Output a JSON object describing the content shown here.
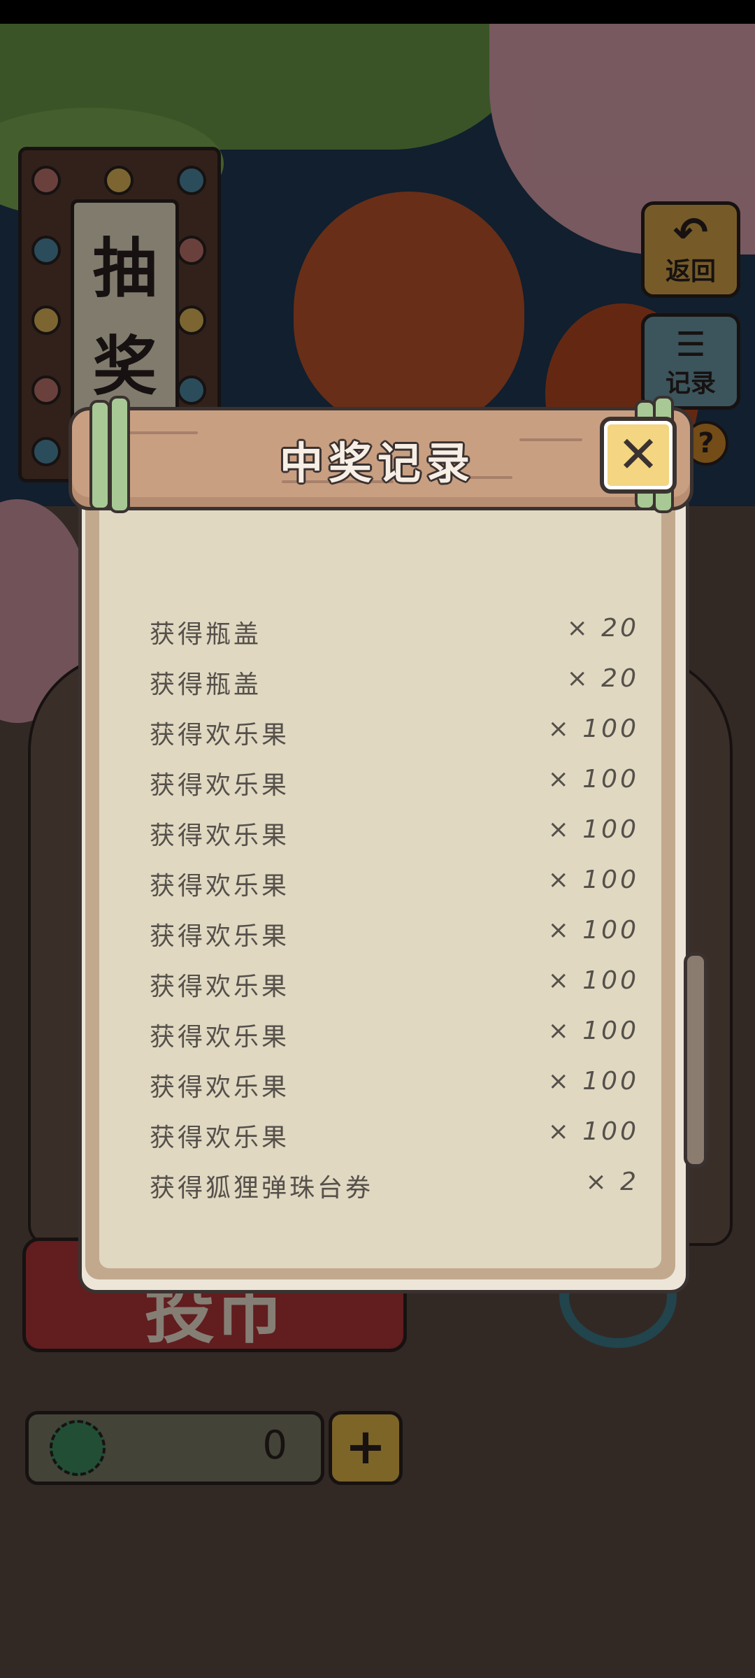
{
  "background": {
    "sign_chars": [
      "抽",
      "奖"
    ],
    "back_button_label": "返回",
    "records_button_label": "记录",
    "help_symbol": "?",
    "coin_button_label": "投币",
    "currency_value": "0",
    "add_symbol": "+"
  },
  "modal": {
    "title": "中奖记录",
    "close_symbol": "✕",
    "records": [
      {
        "label": "获得瓶盖",
        "qty": "× 20"
      },
      {
        "label": "获得瓶盖",
        "qty": "× 20"
      },
      {
        "label": "获得欢乐果",
        "qty": "× 100"
      },
      {
        "label": "获得欢乐果",
        "qty": "× 100"
      },
      {
        "label": "获得欢乐果",
        "qty": "× 100"
      },
      {
        "label": "获得欢乐果",
        "qty": "× 100"
      },
      {
        "label": "获得欢乐果",
        "qty": "× 100"
      },
      {
        "label": "获得欢乐果",
        "qty": "× 100"
      },
      {
        "label": "获得欢乐果",
        "qty": "× 100"
      },
      {
        "label": "获得欢乐果",
        "qty": "× 100"
      },
      {
        "label": "获得欢乐果",
        "qty": "× 100"
      },
      {
        "label": "获得狐狸弹珠台券",
        "qty": "× 2"
      }
    ]
  },
  "colors": {
    "accent_close": "#f3d582",
    "coin_button": "#b3353a",
    "paper": "#e0d8c1",
    "wood_header": "#c99f82"
  }
}
